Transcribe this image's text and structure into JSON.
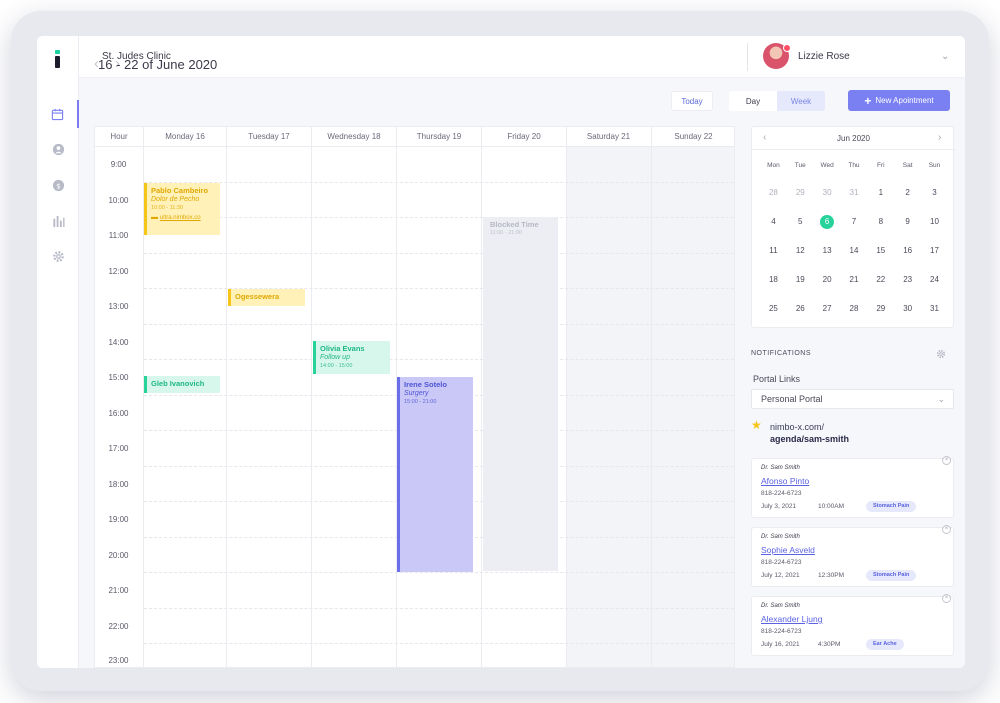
{
  "app": {
    "clinic_name": "St. Judes Clinic",
    "user_name": "Lizzie Rose",
    "sidebar_icons": [
      "calendar-icon",
      "user-icon",
      "billing-icon",
      "stats-icon",
      "settings-icon"
    ]
  },
  "toolbar": {
    "date_range": "16 - 22 of June 2020",
    "today_label": "Today",
    "day_label": "Day",
    "week_label": "Week",
    "new_appointment_label": "New Apointment"
  },
  "calendar": {
    "hour_header": "Hour",
    "days": [
      "Monday 16",
      "Tuesday 17",
      "Wednesday 18",
      "Thursday 19",
      "Friday 20",
      "Saturday 21",
      "Sunday 22"
    ],
    "hours": [
      "9:00",
      "10:00",
      "11:00",
      "12:00",
      "13:00",
      "14:00",
      "15:00",
      "16:00",
      "17:00",
      "18:00",
      "19:00",
      "20:00",
      "21:00",
      "22:00",
      "23:00"
    ],
    "events": {
      "pablo": {
        "title": "Pablo Cambeiro",
        "subtitle": "Dolor de Pecho",
        "time": "10:00 - 11:30",
        "link": "ultra.nimbox.co"
      },
      "ogessewera": {
        "title": "Ogessewera"
      },
      "olivia": {
        "title": "Olivia Evans",
        "subtitle": "Follow up",
        "time": "14:00 - 15:00"
      },
      "gleb": {
        "title": "Gleb Ivanovich"
      },
      "irene": {
        "title": "Irene Sotelo",
        "subtitle": "Surgery",
        "time": "15:00 - 21:00"
      },
      "blocked": {
        "title": "Blocked Time",
        "time": "11:00 - 21:00"
      }
    }
  },
  "mini_calendar": {
    "title": "Jun 2020",
    "weekdays": [
      "Mon",
      "Tue",
      "Wed",
      "Thu",
      "Fri",
      "Sat",
      "Sun"
    ],
    "weeks": [
      [
        "28",
        "29",
        "30",
        "31",
        "1",
        "2",
        "3"
      ],
      [
        "4",
        "5",
        "6",
        "7",
        "8",
        "9",
        "10"
      ],
      [
        "11",
        "12",
        "13",
        "14",
        "15",
        "16",
        "17"
      ],
      [
        "18",
        "19",
        "20",
        "21",
        "22",
        "23",
        "24"
      ],
      [
        "25",
        "26",
        "27",
        "28",
        "29",
        "30",
        "31"
      ]
    ],
    "selected_day": "6"
  },
  "notifications": {
    "title": "NOTIFICATIONS",
    "portal_label": "Portal Links",
    "portal_select_value": "Personal Portal",
    "portal_url_line1": "nimbo-x.com/",
    "portal_url_line2": "agenda/sam-smith",
    "cards": [
      {
        "doctor": "Dr. Sam Smith",
        "patient": "Afonso Pinto",
        "phone": "818-224-6723",
        "date": "July 3, 2021",
        "time": "10:00AM",
        "tag": "Stomach Pain"
      },
      {
        "doctor": "Dr. Sam Smith",
        "patient": "Sophie Asveld",
        "phone": "818-224-6723",
        "date": "July 12, 2021",
        "time": "12:30PM",
        "tag": "Stomach Pain"
      },
      {
        "doctor": "Dr. Sam Smith",
        "patient": "Alexander Ljung",
        "phone": "818-224-6723",
        "date": "July 16, 2021",
        "time": "4:30PM",
        "tag": "Ear Ache"
      }
    ]
  },
  "colors": {
    "accent": "#7a80f2",
    "green": "#27d39a",
    "yellow": "#f5c518",
    "purple": "#6a6ee8"
  }
}
